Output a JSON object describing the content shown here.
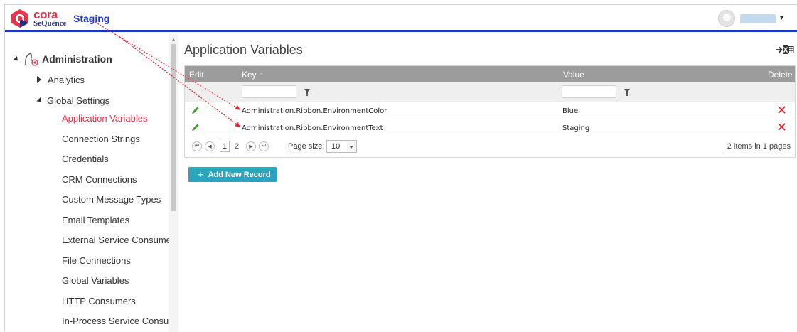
{
  "header": {
    "logo_cora": "cora",
    "logo_sequence": "SeQuence",
    "environment_text": "Staging",
    "environment_color": "#1f34c8",
    "user_menu_caret": "▾"
  },
  "sidebar": {
    "root_label": "Administration",
    "analytics_label": "Analytics",
    "global_settings_label": "Global Settings",
    "items": [
      {
        "label": "Application Variables",
        "active": true
      },
      {
        "label": "Connection Strings"
      },
      {
        "label": "Credentials"
      },
      {
        "label": "CRM Connections"
      },
      {
        "label": "Custom Message Types"
      },
      {
        "label": "Email Templates"
      },
      {
        "label": "External Service Consumers"
      },
      {
        "label": "File Connections"
      },
      {
        "label": "Global Variables"
      },
      {
        "label": "HTTP Consumers"
      },
      {
        "label": "In-Process Service Consume"
      }
    ]
  },
  "main": {
    "title": "Application Variables",
    "grid": {
      "columns": {
        "edit": "Edit",
        "key": "Key",
        "value": "Value",
        "delete": "Delete"
      },
      "sort_indicator": "⌃",
      "rows": [
        {
          "key": "Administration.Ribbon.EnvironmentColor",
          "value": "Blue"
        },
        {
          "key": "Administration.Ribbon.EnvironmentText",
          "value": "Staging"
        }
      ],
      "delete_glyph": "✕"
    },
    "pager": {
      "first": "⏮",
      "prev": "◀",
      "pages": [
        "1",
        "2"
      ],
      "current_page": "1",
      "next": "▶",
      "last": "⏭",
      "page_size_label": "Page size:",
      "page_size": "10",
      "info": "2 items in 1 pages"
    },
    "add_button": {
      "plus": "+",
      "label": "Add New Record"
    }
  },
  "colors": {
    "accent_red": "#e8344a",
    "header_bar": "#9c9c9c",
    "add_button": "#2aa4bf",
    "delete": "#e8232f",
    "edit_pencil": "#3b9c2c"
  }
}
